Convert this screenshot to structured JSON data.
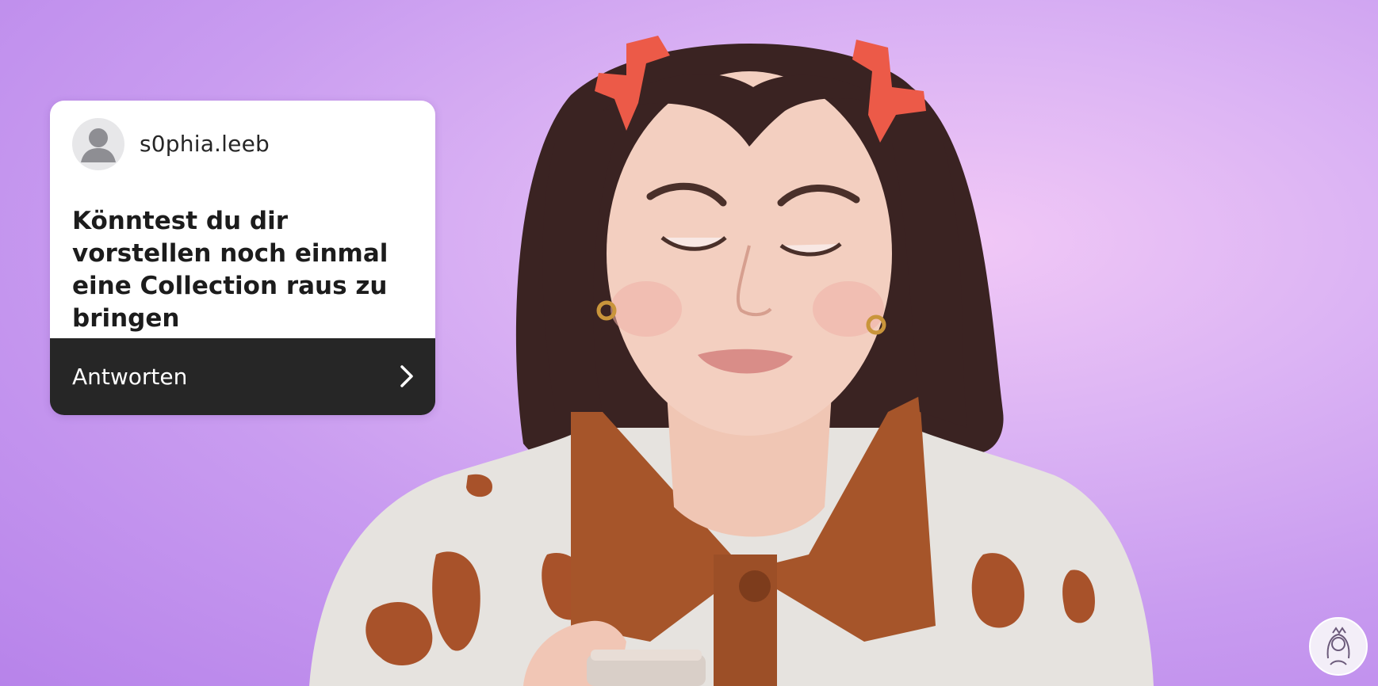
{
  "question_card": {
    "username": "s0phia.leeb",
    "question": "Könntest du dir vorstellen noch einmal eine Collection raus zu bringen",
    "reply_label": "Antworten",
    "avatar_icon": "default-profile-icon",
    "chevron_icon": "chevron-right-icon",
    "colors": {
      "card_background": "#ffffff",
      "reply_bar_background": "#262626",
      "text_dark": "#1c1c1c",
      "text_light": "#ffffff"
    }
  },
  "background": {
    "colors": [
      "#f1c8f6",
      "#dcb4f4",
      "#c99cf0",
      "#b783ea"
    ]
  },
  "channel_logo": {
    "icon": "channel-logo-icon"
  }
}
